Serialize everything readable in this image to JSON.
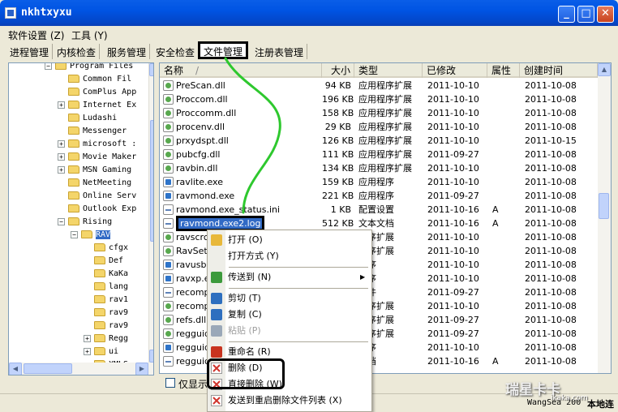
{
  "window": {
    "title": "nkhtxyxu",
    "min": "_",
    "max": "□",
    "close": "✕"
  },
  "menu": [
    "软件设置 (Z)",
    "工具 (Y)"
  ],
  "tabs": [
    "进程管理",
    "内核检查",
    "服务管理",
    "安全检查",
    "文件管理",
    "注册表管理"
  ],
  "tree": [
    {
      "label": "Program Files",
      "exp": "−"
    },
    {
      "label": "Common Fil",
      "exp": ""
    },
    {
      "label": "ComPlus App",
      "exp": ""
    },
    {
      "label": "Internet Ex",
      "exp": "+"
    },
    {
      "label": "Ludashi",
      "exp": ""
    },
    {
      "label": "Messenger",
      "exp": ""
    },
    {
      "label": "microsoft :",
      "exp": "+"
    },
    {
      "label": "Movie Maker",
      "exp": "+"
    },
    {
      "label": "MSN Gaming",
      "exp": "+"
    },
    {
      "label": "NetMeeting",
      "exp": ""
    },
    {
      "label": "Online Serv",
      "exp": ""
    },
    {
      "label": "Outlook Exp",
      "exp": ""
    },
    {
      "label": "Rising",
      "exp": "−"
    },
    {
      "label": "RAV",
      "exp": "−"
    },
    {
      "label": "cfgx",
      "exp": ""
    },
    {
      "label": "Def",
      "exp": ""
    },
    {
      "label": "KaKa",
      "exp": ""
    },
    {
      "label": "lang",
      "exp": ""
    },
    {
      "label": "rav1",
      "exp": ""
    },
    {
      "label": "rav9",
      "exp": ""
    },
    {
      "label": "rav9",
      "exp": ""
    },
    {
      "label": "Regg",
      "exp": "+"
    },
    {
      "label": "ui",
      "exp": "+"
    },
    {
      "label": "XMLS",
      "exp": ""
    }
  ],
  "columns": [
    "名称",
    "大小",
    "类型",
    "已修改",
    "属性",
    "创建时间"
  ],
  "sort_indicator": "/",
  "rows": [
    {
      "name": "PreScan.dll",
      "size": "94 KB",
      "type": "应用程序扩展",
      "modified": "2011-10-10",
      "attr": "",
      "created": "2011-10-08",
      "icon": "dll"
    },
    {
      "name": "Proccom.dll",
      "size": "196 KB",
      "type": "应用程序扩展",
      "modified": "2011-10-10",
      "attr": "",
      "created": "2011-10-08",
      "icon": "dll"
    },
    {
      "name": "Proccomm.dll",
      "size": "158 KB",
      "type": "应用程序扩展",
      "modified": "2011-10-10",
      "attr": "",
      "created": "2011-10-08",
      "icon": "dll"
    },
    {
      "name": "procenv.dll",
      "size": "29 KB",
      "type": "应用程序扩展",
      "modified": "2011-10-10",
      "attr": "",
      "created": "2011-10-08",
      "icon": "dll"
    },
    {
      "name": "prxydspt.dll",
      "size": "126 KB",
      "type": "应用程序扩展",
      "modified": "2011-10-10",
      "attr": "",
      "created": "2011-10-15",
      "icon": "dll"
    },
    {
      "name": "pubcfg.dll",
      "size": "111 KB",
      "type": "应用程序扩展",
      "modified": "2011-09-27",
      "attr": "",
      "created": "2011-10-08",
      "icon": "dll"
    },
    {
      "name": "ravbin.dll",
      "size": "134 KB",
      "type": "应用程序扩展",
      "modified": "2011-10-10",
      "attr": "",
      "created": "2011-10-08",
      "icon": "dll"
    },
    {
      "name": "ravlite.exe",
      "size": "159 KB",
      "type": "应用程序",
      "modified": "2011-10-10",
      "attr": "",
      "created": "2011-10-08",
      "icon": "exe"
    },
    {
      "name": "ravmond.exe",
      "size": "221 KB",
      "type": "应用程序",
      "modified": "2011-09-27",
      "attr": "",
      "created": "2011-10-08",
      "icon": "exe"
    },
    {
      "name": "ravmond.exe_status.ini",
      "size": "1 KB",
      "type": "配置设置",
      "modified": "2011-10-16",
      "attr": "A",
      "created": "2011-10-08",
      "icon": "log"
    },
    {
      "name": "ravmond.exe2.log",
      "size": "512 KB",
      "type": "文本文档",
      "modified": "2011-10-16",
      "attr": "A",
      "created": "2011-10-08",
      "icon": "log",
      "highlight": true
    },
    {
      "name": "ravscrch",
      "size": "",
      "type": "程序扩展",
      "modified": "2011-10-10",
      "attr": "",
      "created": "2011-10-08",
      "icon": "dll"
    },
    {
      "name": "RavSetu",
      "size": "",
      "type": "程序扩展",
      "modified": "2011-10-10",
      "attr": "",
      "created": "2011-10-08",
      "icon": "dll"
    },
    {
      "name": "ravusb.e",
      "size": "",
      "type": "程序",
      "modified": "2011-10-10",
      "attr": "",
      "created": "2011-10-08",
      "icon": "exe"
    },
    {
      "name": "ravxp.ex",
      "size": "",
      "type": "程序",
      "modified": "2011-10-10",
      "attr": "",
      "created": "2011-10-08",
      "icon": "exe"
    },
    {
      "name": "recomp.",
      "size": "",
      "type": "文件",
      "modified": "2011-09-27",
      "attr": "",
      "created": "2011-10-08",
      "icon": "log"
    },
    {
      "name": "recomp.",
      "size": "",
      "type": "程序扩展",
      "modified": "2011-10-10",
      "attr": "",
      "created": "2011-10-08",
      "icon": "dll"
    },
    {
      "name": "refs.dll",
      "size": "",
      "type": "程序扩展",
      "modified": "2011-09-27",
      "attr": "",
      "created": "2011-10-08",
      "icon": "dll"
    },
    {
      "name": "regguide",
      "size": "",
      "type": "程序扩展",
      "modified": "2011-09-27",
      "attr": "",
      "created": "2011-10-08",
      "icon": "dll"
    },
    {
      "name": "regguide",
      "size": "",
      "type": "程序",
      "modified": "2011-10-10",
      "attr": "",
      "created": "2011-10-08",
      "icon": "exe"
    },
    {
      "name": "regguide",
      "size": "",
      "type": "文档",
      "modified": "2011-10-16",
      "attr": "A",
      "created": "2011-10-08",
      "icon": "log"
    }
  ],
  "bottom": {
    "checkbox_label": "仅显示"
  },
  "context_menu": [
    {
      "label": "打开 (O)",
      "sep_after": false
    },
    {
      "label": "打开方式 (Y)",
      "sep_after": true
    },
    {
      "label": "传送到 (N)",
      "arrow": "▶",
      "sep_after": true
    },
    {
      "label": "剪切 (T)",
      "sep_after": false
    },
    {
      "label": "复制 (C)",
      "sep_after": false
    },
    {
      "label": "粘贴 (P)",
      "disabled": true,
      "sep_after": true
    },
    {
      "label": "重命名 (R)",
      "sep_after": false
    },
    {
      "label": "删除 (D)",
      "sep_after": false
    },
    {
      "label": "直接删除 (W)",
      "sep_after": false
    },
    {
      "label": "发送到重启删除文件列表 (X)",
      "sep_after": false
    }
  ],
  "status": {
    "credit": "WangSea 200",
    "right": "本地连"
  },
  "watermark": {
    "main": "瑞星卡卡",
    "sub": "ikaka.com"
  },
  "colors": {
    "title_blue": "#0054E3",
    "selection": "#316AC5",
    "annotation_green": "#2EC82E"
  }
}
